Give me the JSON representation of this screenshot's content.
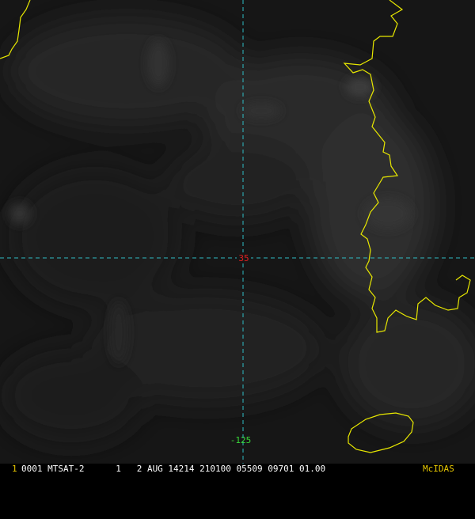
{
  "image": {
    "background_color": "#161616",
    "coastline_color": "#e8e800",
    "grid_color": "#2fbcc4"
  },
  "grid": {
    "latitude_label": "35",
    "latitude_label_color": "#e02020",
    "longitude_label": "-125",
    "longitude_label_color": "#38d838"
  },
  "status_bar": {
    "frame_number": "1",
    "frame_number_color": "#e8c800",
    "info": "0001 MTSAT-2      1   2 AUG 14214 210100 05509 09701 01.00",
    "info_color": "#ffffff",
    "brand": "McIDAS",
    "brand_color": "#e8c800"
  }
}
